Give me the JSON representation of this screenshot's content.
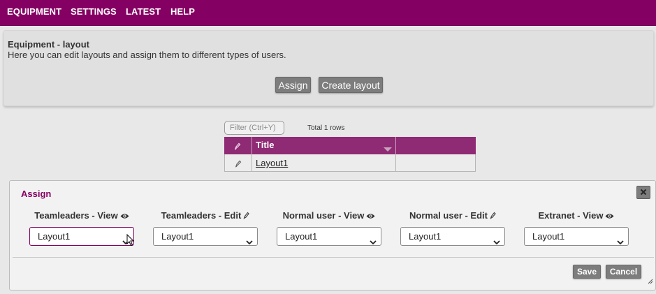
{
  "nav": {
    "items": [
      {
        "label": "EQUIPMENT"
      },
      {
        "label": "SETTINGS"
      },
      {
        "label": "LATEST"
      },
      {
        "label": "HELP"
      }
    ]
  },
  "header": {
    "title": "Equipment - layout",
    "description": "Here you can edit layouts and assign them to different types of users.",
    "assign_label": "Assign",
    "create_label": "Create layout"
  },
  "grid": {
    "filter_placeholder": "Filter (Ctrl+Y)",
    "total_text": "Total 1 rows",
    "column_title": "Title",
    "rows": [
      {
        "title": "Layout1"
      }
    ]
  },
  "assign": {
    "title": "Assign",
    "columns": [
      {
        "label": "Teamleaders - View",
        "icon": "eye-icon",
        "value": "Layout1"
      },
      {
        "label": "Teamleaders - Edit",
        "icon": "pencil-icon",
        "value": "Layout1"
      },
      {
        "label": "Normal user - View",
        "icon": "eye-icon",
        "value": "Layout1"
      },
      {
        "label": "Normal user - Edit",
        "icon": "pencil-icon",
        "value": "Layout1"
      },
      {
        "label": "Extranet - View",
        "icon": "eye-icon",
        "value": "Layout1"
      }
    ],
    "save_label": "Save",
    "cancel_label": "Cancel"
  },
  "colors": {
    "brand": "#850063",
    "header_row": "#8f2a74",
    "button": "#7d7d7d"
  }
}
